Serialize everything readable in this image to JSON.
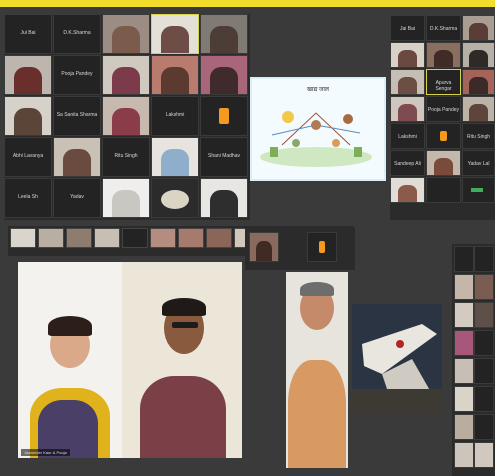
{
  "colors": {
    "accent_stripe": "#f2de2a",
    "orange_button": "#f39a1f",
    "panel_bg": "#2b2b2b"
  },
  "top_grid": {
    "names": [
      "Jui Bai",
      "D.K.Sharma",
      "",
      "",
      "Pooja Pandey",
      "",
      "Apurva Sengar",
      "",
      "",
      "Sa Sanita Sharma",
      "",
      "Lakshmi",
      "",
      "Abhi Lavanya",
      "",
      "Ritu Singh",
      "",
      "Shani Madhav",
      "Leela Sh",
      "Yadav",
      "",
      "",
      "",
      "",
      ""
    ]
  },
  "slide": {
    "title": "खाद्य जाल"
  },
  "right_grid": {
    "names": [
      "Jai Bai",
      "D.K.Sharma",
      "",
      "",
      "",
      "Apurva Sengar",
      "",
      "Pooja Pandey",
      "",
      "Lakshmi",
      "",
      "Ritu Singh",
      "Sandeep Ali",
      "",
      "Yadav Lal",
      "",
      "",
      ""
    ]
  },
  "big_videos": [
    {
      "caption": "Jaswinder Kaur & Pooja"
    },
    {
      "caption": ""
    },
    {
      "caption": ""
    }
  ]
}
